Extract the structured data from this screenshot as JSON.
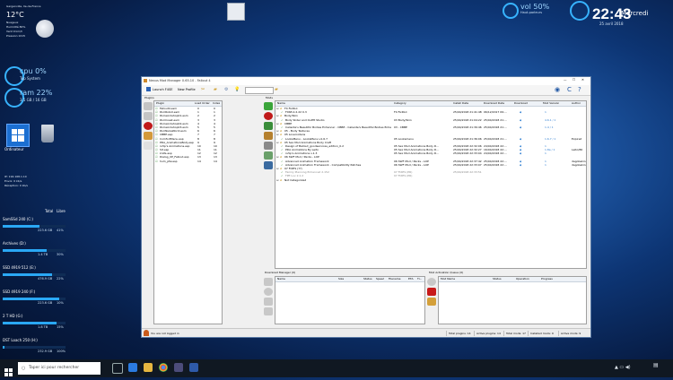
{
  "weather": {
    "city": "Gargenville, Ile-de-France",
    "temp": "12°C",
    "lines": [
      "Nuageux",
      "Humidité 80%",
      "Vent 9 km/h",
      "Pression 1015"
    ]
  },
  "cpu": {
    "label": "cpu 0%",
    "sub": "Top System",
    "value": 0
  },
  "ram": {
    "label": "ram 22%",
    "sub": "3.5 GB / 16 GB",
    "value": 22
  },
  "desktop_icons": {
    "computer": "Ordinateur",
    "recycle": "Corbeille"
  },
  "network": {
    "lines": [
      "IP: 192.168.1.10",
      "Envoi: 0 kb/s",
      "Réception: 0 kb/s"
    ]
  },
  "drives_header": {
    "total": "Total",
    "free": "Libre"
  },
  "drives": [
    {
      "name": "SamSSd 240 (C:)",
      "total": "223.6 GB",
      "free": "41%",
      "fill": 59
    },
    {
      "name": "Archives (D:)",
      "total": "1.4 TB",
      "free": "30%",
      "fill": 70
    },
    {
      "name": "SSD 4919 512 (E:)",
      "total": "476.9 GB",
      "free": "22%",
      "fill": 78
    },
    {
      "name": "SSD 4919 240 (F:)",
      "total": "223.6 GB",
      "free": "10%",
      "fill": 90
    },
    {
      "name": "2 T HD (G:)",
      "total": "1.8 TB",
      "free": "15%",
      "fill": 85
    },
    {
      "name": "DST Loach 250 (H:)",
      "total": "232.9 GB",
      "free": "100%",
      "fill": 3
    }
  ],
  "volume": {
    "label": "vol 50%",
    "sub": "Haut-parleurs",
    "value": 50
  },
  "clock": {
    "time": "22:43",
    "day": "Mercredi",
    "date": "25 avril 2018"
  },
  "app": {
    "title": "Nexus Mod Manager 0.65.10 - Fallout 4",
    "toolbar": [
      "Launch F4SE",
      "New Profile"
    ],
    "plugins_header": "Plugins",
    "plugins_columns": [
      "Plugin",
      "Load Order",
      "Index"
    ],
    "plugins": [
      [
        "Fallout4.esm",
        "0",
        "0"
      ],
      [
        "DLCRobot.esm",
        "1",
        "1"
      ],
      [
        "DLCworkshop01.esm",
        "2",
        "2"
      ],
      [
        "DLCCoast.esm",
        "3",
        "3"
      ],
      [
        "DLCworkshop02.esm",
        "4",
        "4"
      ],
      [
        "DLCworkshop03.esm",
        "5",
        "5"
      ],
      [
        "DLCNukaWorld.esm",
        "6",
        "6"
      ],
      [
        "CBBE.esp",
        "7",
        "7"
      ],
      [
        "ComfortMenu.esp",
        "8",
        "8"
      ],
      [
        "PDA_AnimationsBody.esp",
        "9",
        "9"
      ],
      [
        "ru5p's Animations.esp",
        "10",
        "10"
      ],
      [
        "Sit.esp",
        "11",
        "11"
      ],
      [
        "knife.esp",
        "12",
        "12"
      ],
      [
        "Dialog_XP_Fallout.esp",
        "13",
        "13"
      ],
      [
        "hum_pfw.esp",
        "14",
        "14"
      ]
    ],
    "mods_header": "Mods",
    "mods_columns": [
      "Name",
      "Category",
      "Install Date",
      "Download Date",
      "Download",
      "Mod Version",
      "Author"
    ],
    "mods": [
      {
        "group": true,
        "name": "F4 FixDLC"
      },
      {
        "name": "F4SE-0.2.22 0.3",
        "cat": "F4 FixDLC",
        "install": "25/04/2018 21:41:48",
        "dl": "06/12/2017 09:...",
        "ver": "1",
        "author": ""
      },
      {
        "group": true,
        "name": "Body/Skin"
      },
      {
        "name": "Body Slider and Outfit Studio",
        "cat": "03 Body/Skin",
        "install": "25/04/2018 21:04:22",
        "dl": "25/04/2018 21:...",
        "ver": "4.6.1 / 1",
        "author": ""
      },
      {
        "group": true,
        "name": "CBBE"
      },
      {
        "name": "Caliente's Beautiful Bodies Enhancer - CBBE - Caliente's Beautiful Bodies Enhan...",
        "cat": "03 - CBBE",
        "install": "25/04/2018 21:39:46",
        "dl": "25/04/2018 21:...",
        "ver": "1.4 / 1",
        "author": ""
      },
      {
        "group": true,
        "name": "05 - Body Textures"
      },
      {
        "group": true,
        "name": "05 Loverootens"
      },
      {
        "name": "LooksMenu - LooksMenu v1.6.7",
        "cat": "05 Looksmenu",
        "install": "25/04/2018 21:36:06",
        "dl": "25/04/2018 21:...",
        "ver": "1.6.7 / 1",
        "author": "Expired"
      },
      {
        "group": true,
        "name": "05 Sex Mod Animations Body Craft"
      },
      {
        "name": "Design of Ballout_goodservices_edition_0.2",
        "cat": "05 Sex Mod Animations Body D...",
        "install": "25/04/2018 22:32:06",
        "dl": "24/04/2018 22:...",
        "ver": "1",
        "author": ""
      },
      {
        "name": "PDA Animations By Leito",
        "cat": "05 Sex Mod Animations Body D...",
        "install": "25/04/2018 22:32:27",
        "dl": "16/04/2018 22:...",
        "ver": "1.8a / 1",
        "author": "Leito/86"
      },
      {
        "name": "ru5p's Animations v.1.3",
        "cat": "05 Sex Mod Animations Body D...",
        "install": "25/04/2018 22:33:04",
        "dl": "24/04/2018 22:...",
        "ver": "1",
        "author": ""
      },
      {
        "group": true,
        "name": "06 SWF Mod / Packs - LOP"
      },
      {
        "name": "Advanced Animation Framework",
        "cat": "06 SWF Mod / Packs - LOP",
        "install": "25/04/2018 22:37:42",
        "dl": "25/04/2018 22:...",
        "ver": "1",
        "author": "dagobaking"
      },
      {
        "name": "Advanced Animation Framework - Compatibility Patches",
        "cat": "06 SWF Mod / Packs - LOP",
        "install": "25/04/2018 22:33:07",
        "dl": "25/04/2018 22:...",
        "ver": "1",
        "author": "dagobaking"
      },
      {
        "group": true,
        "name": "07 FIXES (??)"
      },
      {
        "name": "Family Planning Enhanced 2.152",
        "cat": "07 FIXES (PR)",
        "install": "25/04/2018 22:33:51",
        "dl": "",
        "ver": "",
        "author": "",
        "dim": true
      },
      {
        "name": "FPE Lov 2.1.2",
        "cat": "07 FIXES (PR)",
        "install": "",
        "dl": "",
        "ver": "",
        "author": "",
        "dim": true
      },
      {
        "group": true,
        "name": "Not Categorized"
      }
    ],
    "download_header": "Download Manager (0)",
    "download_columns": [
      "Name",
      "Size",
      "Status",
      "Speed",
      "Filename",
      "ETA",
      "Ti..."
    ],
    "activation_header": "Mod Activation Queue (0)",
    "activation_columns": [
      "Mod Name",
      "Status",
      "Operation",
      "Progress"
    ],
    "login_status": "You are not logged in",
    "status_items": [
      "Total plugins: 14",
      "Active plugins: 14",
      "Total mods: 17",
      "Installed mods: 9",
      "Active mods: 9"
    ]
  },
  "taskbar": {
    "search_placeholder": "Taper ici pour rechercher"
  }
}
